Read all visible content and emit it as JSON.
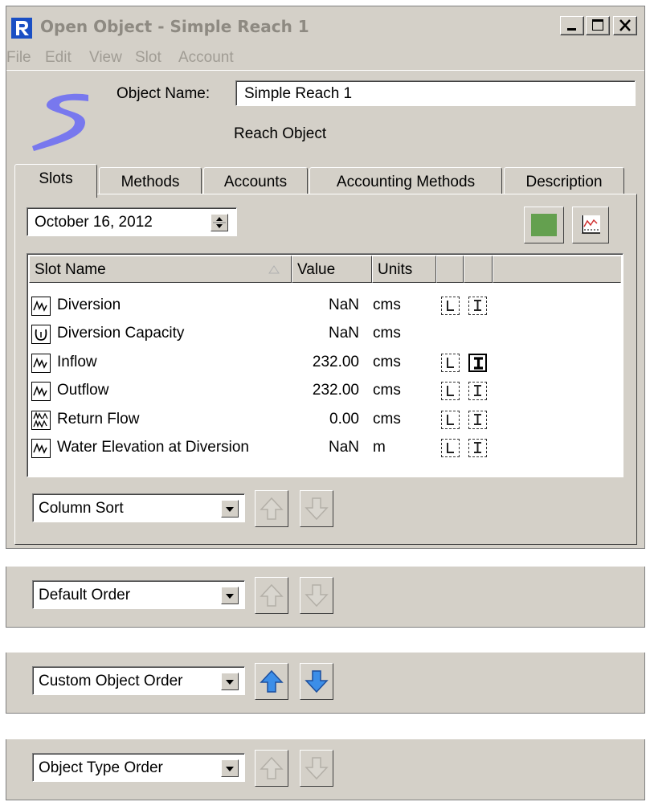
{
  "window": {
    "title": "Open Object - Simple Reach 1",
    "controls": [
      "minimize",
      "maximize",
      "close"
    ]
  },
  "menu": [
    "File",
    "Edit",
    "View",
    "Slot",
    "Account"
  ],
  "object": {
    "name_label": "Object Name:",
    "name_value": "Simple Reach 1",
    "type": "Reach Object"
  },
  "tabs": [
    "Slots",
    "Methods",
    "Accounts",
    "Accounting Methods",
    "Description"
  ],
  "active_tab": "Slots",
  "date": "October 16, 2012",
  "colors": {
    "accent_green": "#64a04f",
    "arrow_blue": "#3c8ee8",
    "logo_blue": "#7878ee"
  },
  "table": {
    "headers": [
      "Slot Name",
      "Value",
      "Units",
      "",
      ""
    ],
    "rows": [
      {
        "icon": "series-icon",
        "name": "Diversion",
        "value": "NaN",
        "units": "cms"
      },
      {
        "icon": "table-icon",
        "name": "Diversion Capacity",
        "value": "NaN",
        "units": "cms"
      },
      {
        "icon": "series-icon",
        "name": "Inflow",
        "value": "232.00",
        "units": "cms"
      },
      {
        "icon": "series-icon",
        "name": "Outflow",
        "value": "232.00",
        "units": "cms"
      },
      {
        "icon": "agg-series-icon",
        "name": "Return Flow",
        "value": "0.00",
        "units": "cms"
      },
      {
        "icon": "series-icon",
        "name": "Water Elevation at Diversion",
        "value": "NaN",
        "units": "m"
      }
    ]
  },
  "sort_options": [
    {
      "label": "Column Sort",
      "arrows_enabled": false
    },
    {
      "label": "Default Order",
      "arrows_enabled": false
    },
    {
      "label": "Custom Object Order",
      "arrows_enabled": true
    },
    {
      "label": "Object Type Order",
      "arrows_enabled": false
    }
  ]
}
